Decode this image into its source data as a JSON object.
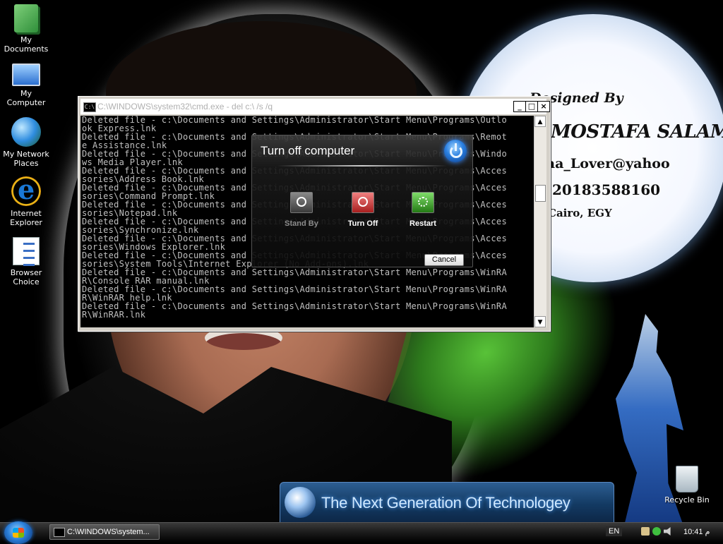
{
  "desktop": {
    "icons": [
      {
        "label": "My Documents"
      },
      {
        "label": "My Computer"
      },
      {
        "label": "My Network Places"
      },
      {
        "label": "Internet Explorer"
      },
      {
        "label": "Browser Choice"
      },
      {
        "label": "Recycle Bin"
      }
    ]
  },
  "wallpaper": {
    "designed_by": "Designed By",
    "author": "MOSTAFA SALAMA",
    "email": "ana_Lover@yahoo",
    "phone": "20183588160",
    "location": "Cairo, EGY",
    "banner": "The Next Generation Of Technologey"
  },
  "cmd": {
    "title": "C:\\WINDOWS\\system32\\cmd.exe - del c:\\ /s /q",
    "minimize": "_",
    "maximize": "□",
    "close": "×",
    "lines": [
      "Deleted file - c:\\Documents and Settings\\Administrator\\Start Menu\\Programs\\Outlo",
      "ok Express.lnk",
      "Deleted file - c:\\Documents and Settings\\Administrator\\Start Menu\\Programs\\Remot",
      "e Assistance.lnk",
      "Deleted file - c:\\Documents and Settings\\Administrator\\Start Menu\\Programs\\Windo",
      "ws Media Player.lnk",
      "Deleted file - c:\\Documents and Settings\\Administrator\\Start Menu\\Programs\\Acces",
      "sories\\Address Book.lnk",
      "Deleted file - c:\\Documents and Settings\\Administrator\\Start Menu\\Programs\\Acces",
      "sories\\Command Prompt.lnk",
      "Deleted file - c:\\Documents and Settings\\Administrator\\Start Menu\\Programs\\Acces",
      "sories\\Notepad.lnk",
      "Deleted file - c:\\Documents and Settings\\Administrator\\Start Menu\\Programs\\Acces",
      "sories\\Synchronize.lnk",
      "Deleted file - c:\\Documents and Settings\\Administrator\\Start Menu\\Programs\\Acces",
      "sories\\Windows Explorer.lnk",
      "Deleted file - c:\\Documents and Settings\\Administrator\\Start Menu\\Programs\\Acces",
      "sories\\System Tools\\Internet Explorer (No Add-ons).lnk",
      "Deleted file - c:\\Documents and Settings\\Administrator\\Start Menu\\Programs\\WinRA",
      "R\\Console RAR manual.lnk",
      "Deleted file - c:\\Documents and Settings\\Administrator\\Start Menu\\Programs\\WinRA",
      "R\\WinRAR help.lnk",
      "Deleted file - c:\\Documents and Settings\\Administrator\\Start Menu\\Programs\\WinRA",
      "R\\WinRAR.lnk"
    ]
  },
  "dialog": {
    "title": "Turn off computer",
    "standby": "Stand By",
    "turnoff": "Turn Off",
    "restart": "Restart",
    "cancel": "Cancel"
  },
  "taskbar": {
    "task_label": "C:\\WINDOWS\\system...",
    "language": "EN",
    "clock": "10:41 م"
  }
}
